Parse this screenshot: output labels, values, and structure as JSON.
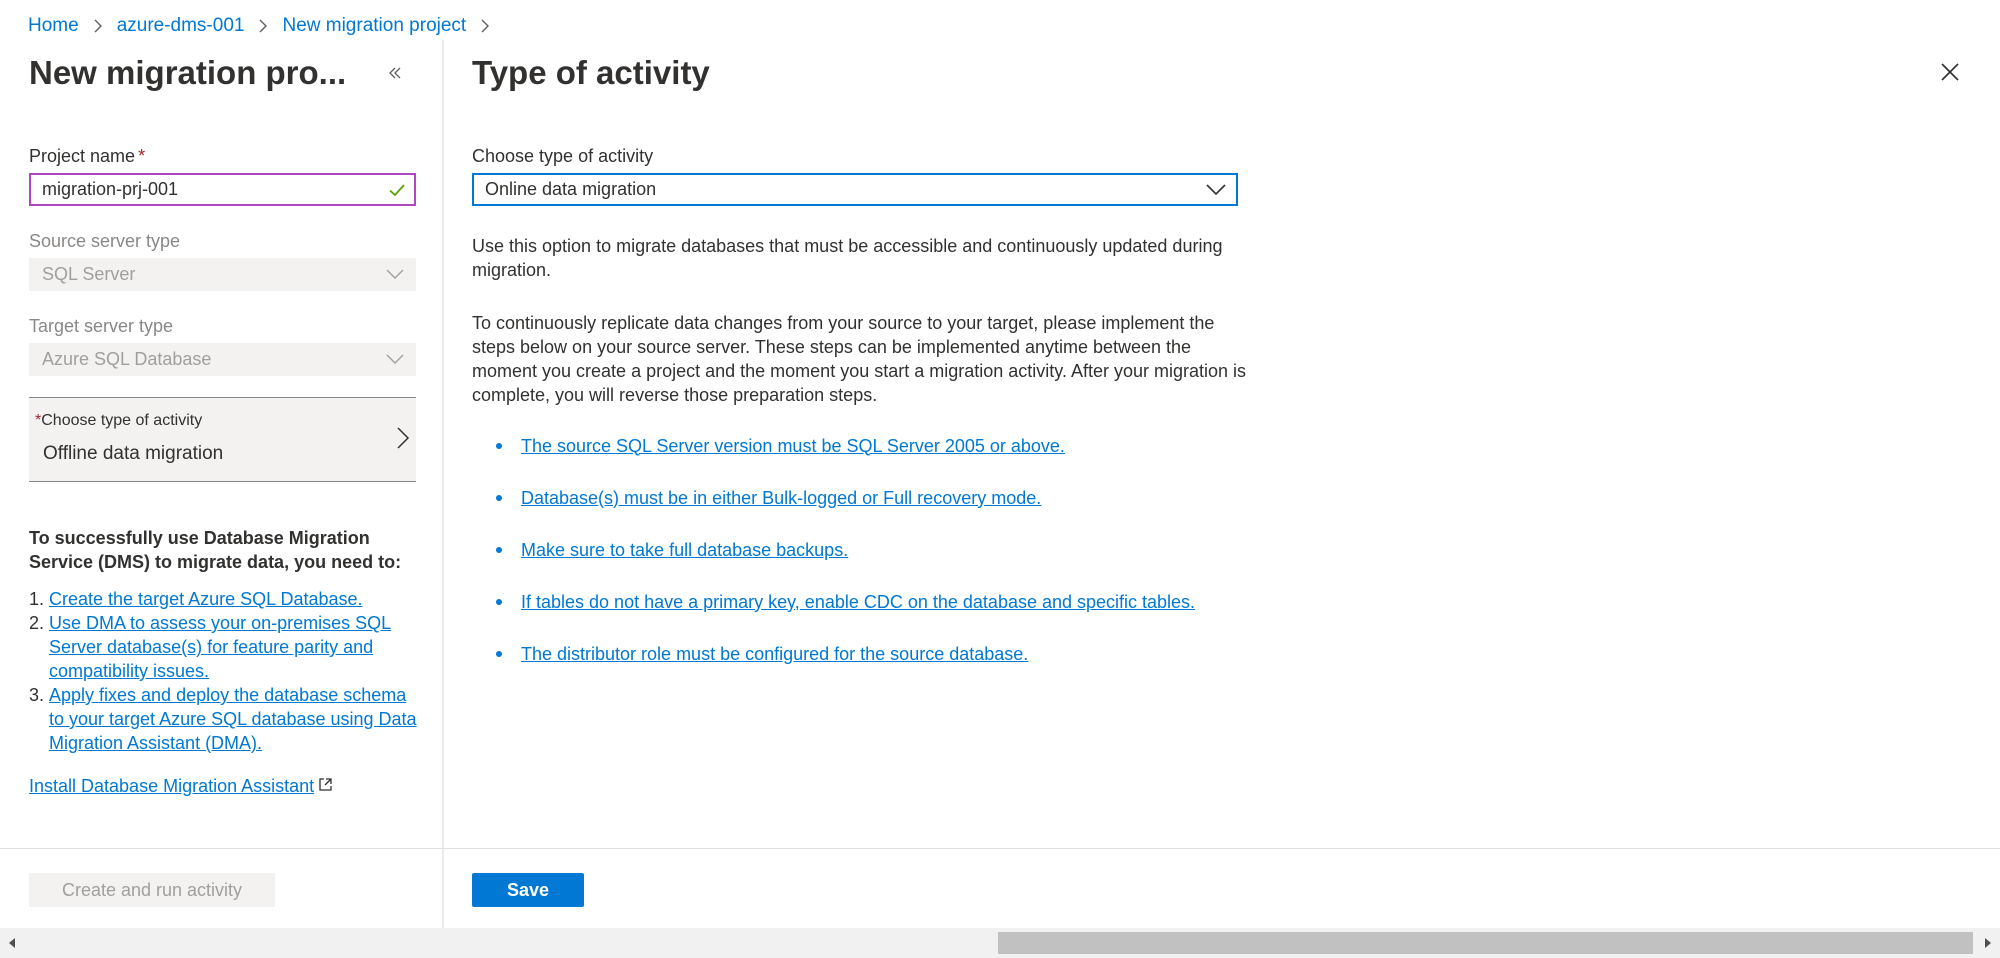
{
  "breadcrumb": {
    "items": [
      "Home",
      "azure-dms-001",
      "New migration project"
    ]
  },
  "left": {
    "title": "New migration pro...",
    "project_name_label": "Project name",
    "required_mark": "*",
    "project_name_value": "migration-prj-001",
    "source_label": "Source server type",
    "source_value": "SQL Server",
    "target_label": "Target server type",
    "target_value": "Azure SQL Database",
    "activity_label": "Choose type of activity",
    "activity_value": "Offline data migration",
    "intro": "To successfully use Database Migration Service (DMS) to migrate data, you need to:",
    "steps": [
      {
        "num": "1.",
        "text": "Create the target Azure SQL Database."
      },
      {
        "num": "2.",
        "text": "Use DMA to assess your on-premises SQL Server database(s) for feature parity and compatibility issues."
      },
      {
        "num": "3.",
        "text": "Apply fixes and deploy the database schema to your target Azure SQL database using Data Migration Assistant (DMA)."
      }
    ],
    "install_link": "Install Database Migration Assistant",
    "create_button": "Create and run activity"
  },
  "right": {
    "title": "Type of activity",
    "select_label": "Choose type of activity",
    "select_value": "Online data migration",
    "para1": "Use this option to migrate databases that must be accessible and continuously updated during migration.",
    "para2": "To continuously replicate data changes from your source to your target, please implement the steps below on your source server. These steps can be implemented anytime between the moment you create a project and the moment you start a migration activity. After your migration is complete, you will reverse those preparation steps.",
    "bullets": [
      "The source SQL Server version must be SQL Server 2005 or above.",
      "Database(s) must be in either Bulk-logged or Full recovery mode.",
      "Make sure to take full database backups.",
      "If tables do not have a primary key, enable CDC on the database and specific tables.",
      "The distributor role must be configured for the source database."
    ],
    "save_button": "Save"
  },
  "colors": {
    "accent": "#0078d4",
    "focus_border": "#b146c2",
    "required": "#a4262c",
    "success": "#57a300"
  }
}
